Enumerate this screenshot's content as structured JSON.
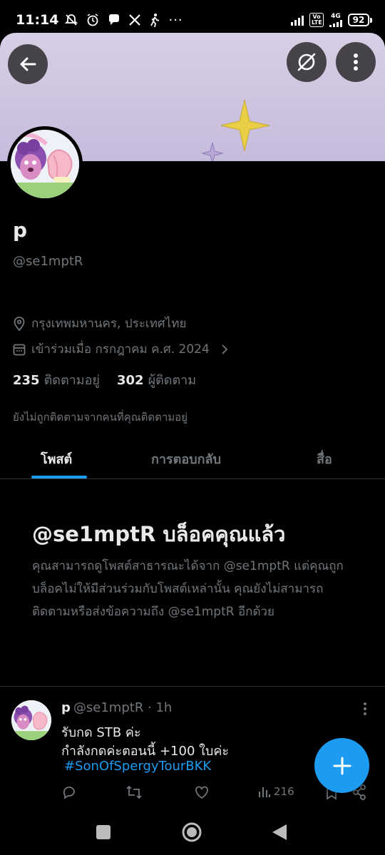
{
  "status_bar": {
    "time": "11:14",
    "icons": [
      "muted-notifications-icon",
      "alarm-icon",
      "chat-bubble-icon",
      "x-logo-icon",
      "walking-icon",
      "more-dots-icon"
    ],
    "volte_label": "Vo LTE",
    "network_label": "4G",
    "battery": "92"
  },
  "header": {
    "back_icon": "arrow-left-icon",
    "grok_icon": "grok-icon",
    "more_icon": "vertical-dots-icon"
  },
  "profile": {
    "name": "p",
    "handle": "@se1mptR",
    "location": "กรุงเทพมหานคร, ประเทศไทย",
    "joined": "เข้าร่วมเมื่อ กรกฎาคม ค.ศ. 2024",
    "following_count": "235",
    "following_label": "ติดตามอยู่",
    "followers_count": "302",
    "followers_label": "ผู้ติดตาม",
    "not_followed_note": "ยังไม่ถูกติดตามจากคนที่คุณติดตามอยู่"
  },
  "tabs": [
    {
      "label": "โพสต์",
      "active": true
    },
    {
      "label": "การตอบกลับ",
      "active": false
    },
    {
      "label": "สื่อ",
      "active": false
    }
  ],
  "blocked": {
    "title": "@se1mptR บล็อคคุณแล้ว",
    "body": "คุณสามารถดูโพสต์สาธารณะได้จาก @se1mptR แต่คุณถูกบล็อคไม่ให้มีส่วนร่วมกับโพสต์เหล่านั้น คุณยังไม่สามารถติดตามหรือส่งข้อความถึง @se1mptR อีกด้วย"
  },
  "tweet": {
    "name": "p",
    "handle_time": "@se1mptR · 1h",
    "line1": "รับกด  STB ค่ะ",
    "line2": "กำลังกดค่ะตอนนี้ +100 ใบค่ะ",
    "hashtag": "#SonOfSpergyTourBKK",
    "views": "216"
  },
  "fab": {
    "icon": "plus-icon"
  },
  "colors": {
    "accent": "#1d9bf0",
    "banner": "#d7cfe4",
    "muted_text": "#71767b",
    "primary_text": "#e7e9ea"
  }
}
